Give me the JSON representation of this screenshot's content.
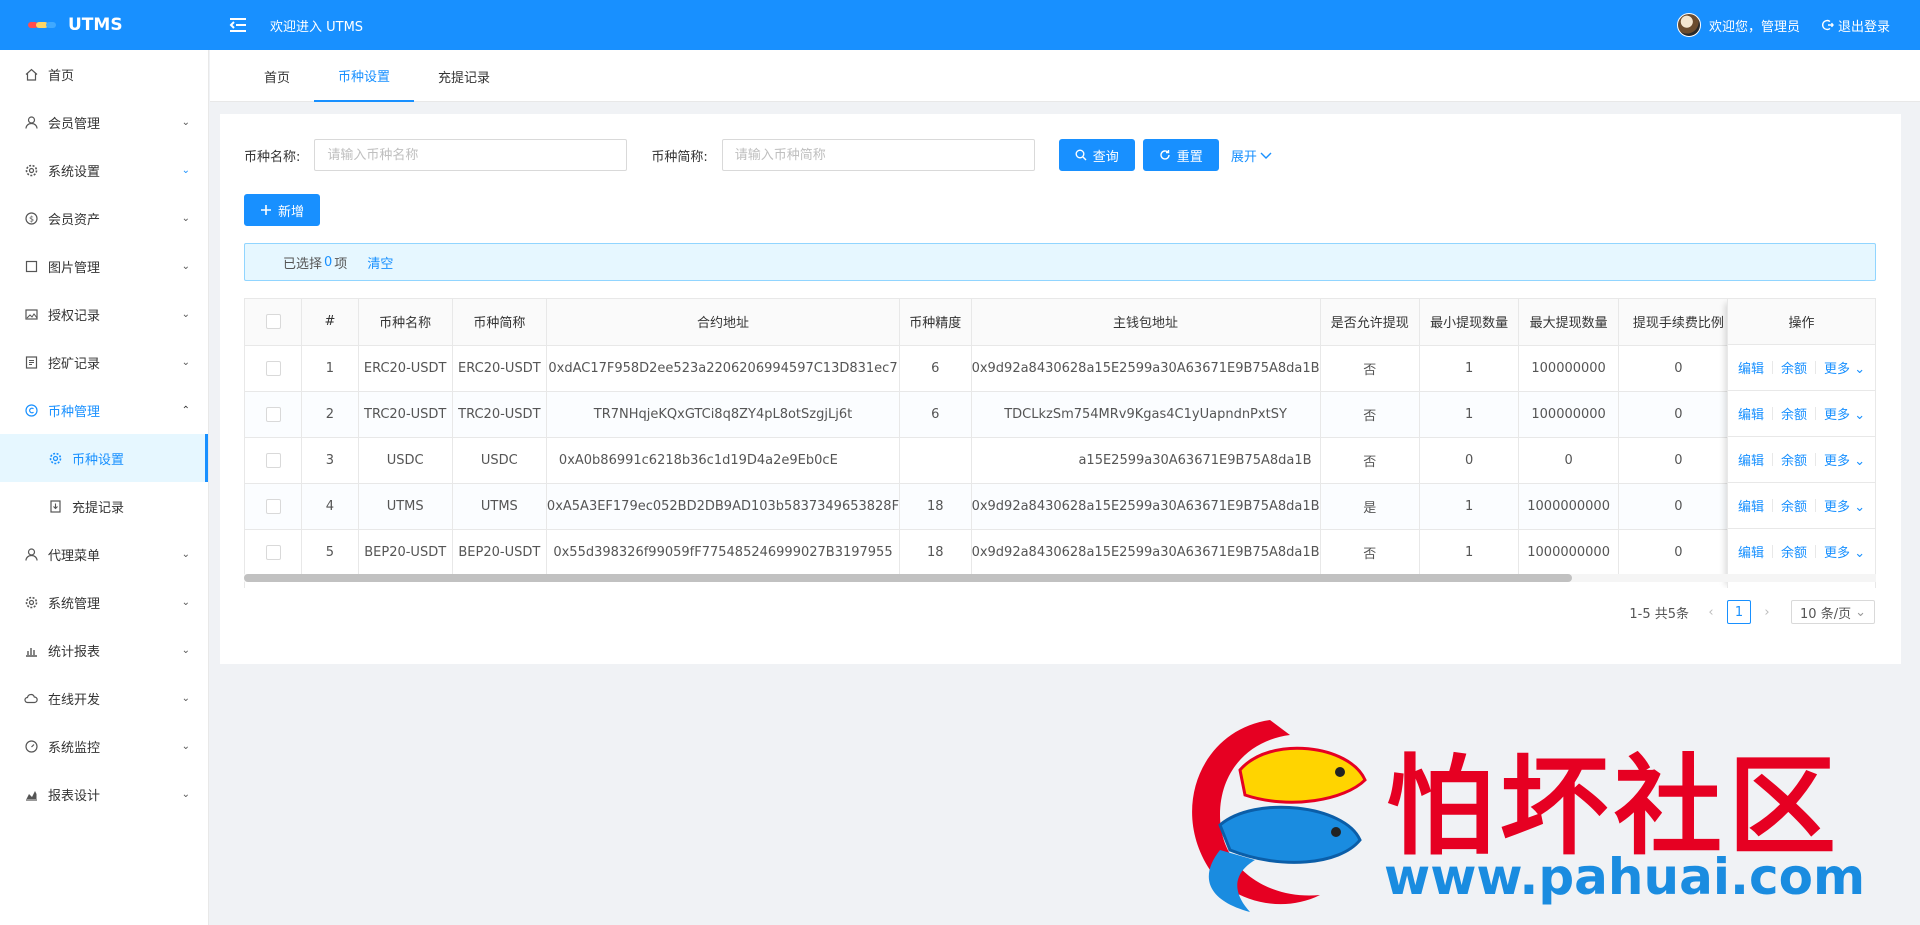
{
  "app": {
    "name": "UTMS",
    "welcome_text": "欢迎进入 UTMS"
  },
  "user": {
    "greeting": "欢迎您，管理员",
    "logout_label": "退出登录"
  },
  "sidebar": {
    "items": [
      {
        "label": "首页",
        "icon": "home-icon"
      },
      {
        "label": "会员管理",
        "icon": "user-icon"
      },
      {
        "label": "系统设置",
        "icon": "gear-icon"
      },
      {
        "label": "会员资产",
        "icon": "dollar-icon"
      },
      {
        "label": "图片管理",
        "icon": "square-icon"
      },
      {
        "label": "授权记录",
        "icon": "image-icon"
      },
      {
        "label": "挖矿记录",
        "icon": "list-icon"
      },
      {
        "label": "币种管理",
        "icon": "copyright-icon"
      },
      {
        "label": "代理菜单",
        "icon": "user-icon"
      },
      {
        "label": "系统管理",
        "icon": "gear-icon"
      },
      {
        "label": "统计报表",
        "icon": "bar-chart-icon"
      },
      {
        "label": "在线开发",
        "icon": "cloud-icon"
      },
      {
        "label": "系统监控",
        "icon": "dashboard-icon"
      },
      {
        "label": "报表设计",
        "icon": "area-chart-icon"
      }
    ],
    "sub_items": [
      {
        "label": "币种设置",
        "icon": "gear-icon"
      },
      {
        "label": "充提记录",
        "icon": "download-icon"
      }
    ]
  },
  "tabs": [
    {
      "label": "首页"
    },
    {
      "label": "币种设置"
    },
    {
      "label": "充提记录"
    }
  ],
  "filter": {
    "name_label": "币种名称:",
    "name_placeholder": "请输入币种名称",
    "short_label": "币种简称:",
    "short_placeholder": "请输入币种简称",
    "query_label": "查询",
    "reset_label": "重置",
    "expand_label": "展开"
  },
  "toolbar": {
    "add_label": "新增"
  },
  "selection": {
    "prefix": "已选择",
    "count": "0",
    "suffix": "项",
    "clear_label": "清空"
  },
  "table": {
    "columns": [
      "#",
      "币种名称",
      "币种简称",
      "合约地址",
      "币种精度",
      "主钱包地址",
      "是否允许提现",
      "最小提现数量",
      "最大提现数量",
      "提现手续费比例",
      "操作"
    ],
    "rows": [
      {
        "idx": "1",
        "name": "ERC20-USDT",
        "short": "ERC20-USDT",
        "contract": "0xdAC17F958D2ee523a2206206994597C13D831ec7",
        "precision": "6",
        "wallet": "0x9d92a8430628a15E2599a30A63671E9B75A8da1B",
        "allow": "否",
        "min": "1",
        "max": "100000000",
        "fee": "0"
      },
      {
        "idx": "2",
        "name": "TRC20-USDT",
        "short": "TRC20-USDT",
        "contract": "TR7NHqjeKQxGTCi8q8ZY4pL8otSzgjLj6t",
        "precision": "6",
        "wallet": "TDCLkzSm754MRv9Kgas4C1yUapndnPxtSY",
        "allow": "否",
        "min": "1",
        "max": "100000000",
        "fee": "0"
      },
      {
        "idx": "3",
        "name": "USDC",
        "short": "USDC",
        "contract": "0xA0b86991c6218b36c1d19D4a2e9Eb0cE",
        "precision": "",
        "wallet": "a15E2599a30A63671E9B75A8da1B",
        "allow": "否",
        "min": "0",
        "max": "0",
        "fee": "0"
      },
      {
        "idx": "4",
        "name": "UTMS",
        "short": "UTMS",
        "contract": "0xA5A3EF179ec052BD2DB9AD103b5837349653828F",
        "precision": "18",
        "wallet": "0x9d92a8430628a15E2599a30A63671E9B75A8da1B",
        "allow": "是",
        "min": "1",
        "max": "1000000000",
        "fee": "0"
      },
      {
        "idx": "5",
        "name": "BEP20-USDT",
        "short": "BEP20-USDT",
        "contract": "0x55d398326f99059fF775485246999027B3197955",
        "precision": "18",
        "wallet": "0x9d92a8430628a15E2599a30A63671E9B75A8da1B",
        "allow": "否",
        "min": "1",
        "max": "1000000000",
        "fee": "0"
      }
    ],
    "actions": {
      "edit": "编辑",
      "balance": "余额",
      "more": "更多"
    }
  },
  "pagination": {
    "summary": "1-5 共5条",
    "current": "1",
    "page_size": "10 条/页"
  },
  "watermark": {
    "title": "怕坏社区",
    "url": "www.pahuai.com"
  },
  "colors": {
    "primary": "#1890ff",
    "watermark_red": "#e60022",
    "watermark_blue": "#1a8ce0"
  }
}
